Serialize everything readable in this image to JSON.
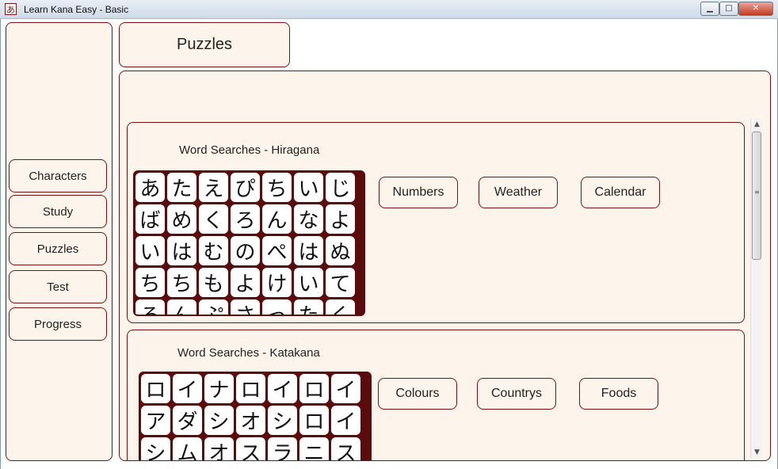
{
  "window": {
    "title": "Learn Kana Easy - Basic",
    "app_icon_glyph": "あ",
    "min_glyph": "▁",
    "max_glyph": "□",
    "close_glyph": "✕"
  },
  "header": {
    "title": "Puzzles"
  },
  "nav": [
    {
      "label": "Characters"
    },
    {
      "label": "Study"
    },
    {
      "label": "Puzzles"
    },
    {
      "label": "Test"
    },
    {
      "label": "Progress"
    }
  ],
  "sections": [
    {
      "title": "Word Searches - Hiragana",
      "puzzles": [
        "Numbers",
        "Weather",
        "Calendar"
      ],
      "grid": [
        [
          "あ",
          "た",
          "え",
          "ぴ",
          "ち",
          "い",
          "じ"
        ],
        [
          "ば",
          "め",
          "く",
          "ろ",
          "ん",
          "な",
          "よ"
        ],
        [
          "い",
          "は",
          "む",
          "の",
          "ぺ",
          "は",
          "ぬ"
        ],
        [
          "ち",
          "ち",
          "も",
          "よ",
          "け",
          "い",
          "て"
        ],
        [
          "ろ",
          "ん",
          "ぷ",
          "さ",
          "っ",
          "た",
          "く"
        ]
      ]
    },
    {
      "title": "Word Searches - Katakana",
      "puzzles": [
        "Colours",
        "Countrys",
        "Foods"
      ],
      "grid": [
        [
          "ロ",
          "イ",
          "ナ",
          "ロ",
          "イ",
          "ロ",
          "イ"
        ],
        [
          "ア",
          "ダ",
          "シ",
          "オ",
          "シ",
          "ロ",
          "イ"
        ],
        [
          "シ",
          "ム",
          "オ",
          "ス",
          "ラ",
          "ニ",
          "ス"
        ]
      ]
    }
  ],
  "colors": {
    "panel_bg": "#fdf5ec",
    "border": "#7a1010",
    "grid_bg": "#5a0b0b"
  }
}
